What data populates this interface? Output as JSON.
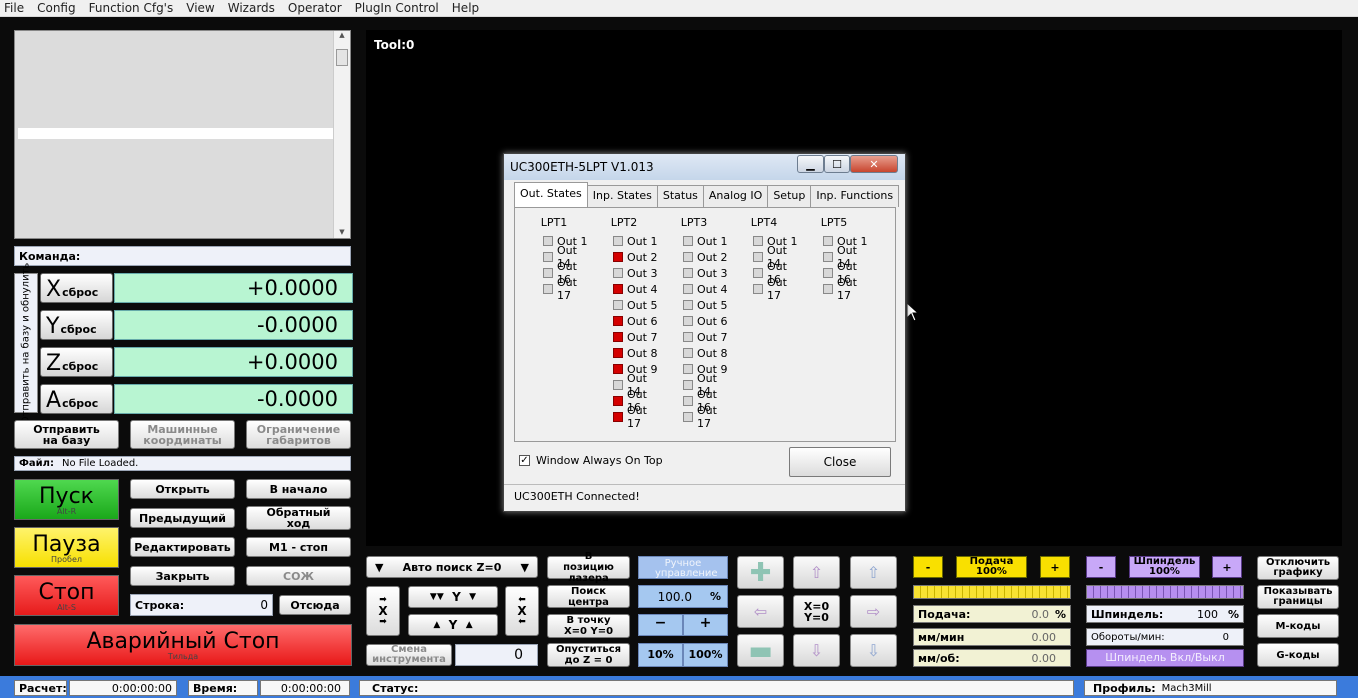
{
  "menu": [
    "File",
    "Config",
    "Function Cfg's",
    "View",
    "Wizards",
    "Operator",
    "PlugIn Control",
    "Help"
  ],
  "tool_label": "Tool:0",
  "command_label": "Команда:",
  "axis_side_label": "Отправить на базу и обнулить",
  "axes": [
    {
      "letter": "X",
      "reset": "сброс",
      "value": "+0.0000"
    },
    {
      "letter": "Y",
      "reset": "сброс",
      "value": "-0.0000"
    },
    {
      "letter": "Z",
      "reset": "сброс",
      "value": "+0.0000"
    },
    {
      "letter": "A",
      "reset": "сброс",
      "value": "-0.0000"
    }
  ],
  "ref_buttons": {
    "home": "Отправить на базу",
    "machine": "Машинные координаты",
    "limits": "Ограничение габаритов"
  },
  "file": {
    "label": "Файл:",
    "value": "No File Loaded."
  },
  "run": {
    "start": "Пуск",
    "start_hk": "Alt-R",
    "pause": "Пауза",
    "pause_hk": "Пробел",
    "stop": "Стоп",
    "stop_hk": "Alt-S",
    "estop": "Аварийный Стоп",
    "estop_hk": "Тильда"
  },
  "file_btns": {
    "open": "Открыть",
    "rewind": "В начало",
    "prev": "Предыдущий",
    "reverse": "Обратный ход",
    "edit": "Редактировать",
    "m1": "M1 - стоп",
    "close": "Закрыть",
    "coolant": "СОЖ",
    "line_label": "Строка:",
    "line_value": "0",
    "from_here": "Отсюда"
  },
  "jog": {
    "auto_z": "Авто поиск Z=0",
    "x": "X",
    "y": "Y",
    "tool_change": "Смена инструмента",
    "tool_value": "0"
  },
  "mid": {
    "laser": "В позицию лазера",
    "find_center": "Поиск центра",
    "goto_zero": "В точку X=0 Y=0",
    "lower_z": "Опуститься до Z = 0",
    "manual": "Ручное управление",
    "percent": "100.0",
    "pct": "%",
    "minus": "−",
    "plus": "+",
    "p10": "10%",
    "p100": "100%"
  },
  "xy_zero": "X=0 Y=0",
  "feed": {
    "minus": "-",
    "plus": "+",
    "label": "Подача 100%",
    "feed": "Подача:",
    "feed_v": "0.0",
    "feed_u": "%",
    "mmmin": "мм/мин",
    "mmmin_v": "0.00",
    "mmrev": "мм/об:",
    "mmrev_v": "0.00"
  },
  "spindle": {
    "minus": "-",
    "plus": "+",
    "label": "Шпиндель 100%",
    "sp": "Шпиндель:",
    "sp_v": "100",
    "sp_u": "%",
    "rpm": "Обороты/мин:",
    "rpm_v": "0",
    "toggle": "Шпиндель Вкл/Выкл"
  },
  "right_btns": {
    "gfx_off": "Отключить графику",
    "show_limits": "Показывать границы",
    "mcodes": "M-коды",
    "gcodes": "G-коды"
  },
  "status": {
    "calc": "Расчет:",
    "calc_v": "0:00:00:00",
    "time": "Время:",
    "time_v": "0:00:00:00",
    "status": "Статус:",
    "profile": "Профиль:",
    "profile_v": "Mach3Mill"
  },
  "dialog": {
    "title": "UC300ETH-5LPT V1.013",
    "tabs": [
      "Out. States",
      "Inp. States",
      "Status",
      "Analog IO",
      "Setup",
      "Inp. Functions"
    ],
    "ports": [
      {
        "name": "LPT1",
        "outs": [
          {
            "l": "Out 1",
            "on": false
          },
          {
            "l": "Out 14",
            "on": false
          },
          {
            "l": "Out 16",
            "on": false
          },
          {
            "l": "Out 17",
            "on": false
          }
        ]
      },
      {
        "name": "LPT2",
        "outs": [
          {
            "l": "Out 1",
            "on": false
          },
          {
            "l": "Out 2",
            "on": true
          },
          {
            "l": "Out 3",
            "on": false
          },
          {
            "l": "Out 4",
            "on": true
          },
          {
            "l": "Out 5",
            "on": false
          },
          {
            "l": "Out 6",
            "on": true
          },
          {
            "l": "Out 7",
            "on": true
          },
          {
            "l": "Out 8",
            "on": true
          },
          {
            "l": "Out 9",
            "on": true
          },
          {
            "l": "Out 14",
            "on": false
          },
          {
            "l": "Out 16",
            "on": true
          },
          {
            "l": "Out 17",
            "on": true
          }
        ]
      },
      {
        "name": "LPT3",
        "outs": [
          {
            "l": "Out 1",
            "on": false
          },
          {
            "l": "Out 2",
            "on": false
          },
          {
            "l": "Out 3",
            "on": false
          },
          {
            "l": "Out 4",
            "on": false
          },
          {
            "l": "Out 5",
            "on": false
          },
          {
            "l": "Out 6",
            "on": false
          },
          {
            "l": "Out 7",
            "on": false
          },
          {
            "l": "Out 8",
            "on": false
          },
          {
            "l": "Out 9",
            "on": false
          },
          {
            "l": "Out 14",
            "on": false
          },
          {
            "l": "Out 16",
            "on": false
          },
          {
            "l": "Out 17",
            "on": false
          }
        ]
      },
      {
        "name": "LPT4",
        "outs": [
          {
            "l": "Out 1",
            "on": false
          },
          {
            "l": "Out 14",
            "on": false
          },
          {
            "l": "Out 16",
            "on": false
          },
          {
            "l": "Out 17",
            "on": false
          }
        ]
      },
      {
        "name": "LPT5",
        "outs": [
          {
            "l": "Out 1",
            "on": false
          },
          {
            "l": "Out 14",
            "on": false
          },
          {
            "l": "Out 16",
            "on": false
          },
          {
            "l": "Out 17",
            "on": false
          }
        ]
      }
    ],
    "always_on_top": "Window Always On Top",
    "close": "Close",
    "connected": "UC300ETH Connected!"
  }
}
